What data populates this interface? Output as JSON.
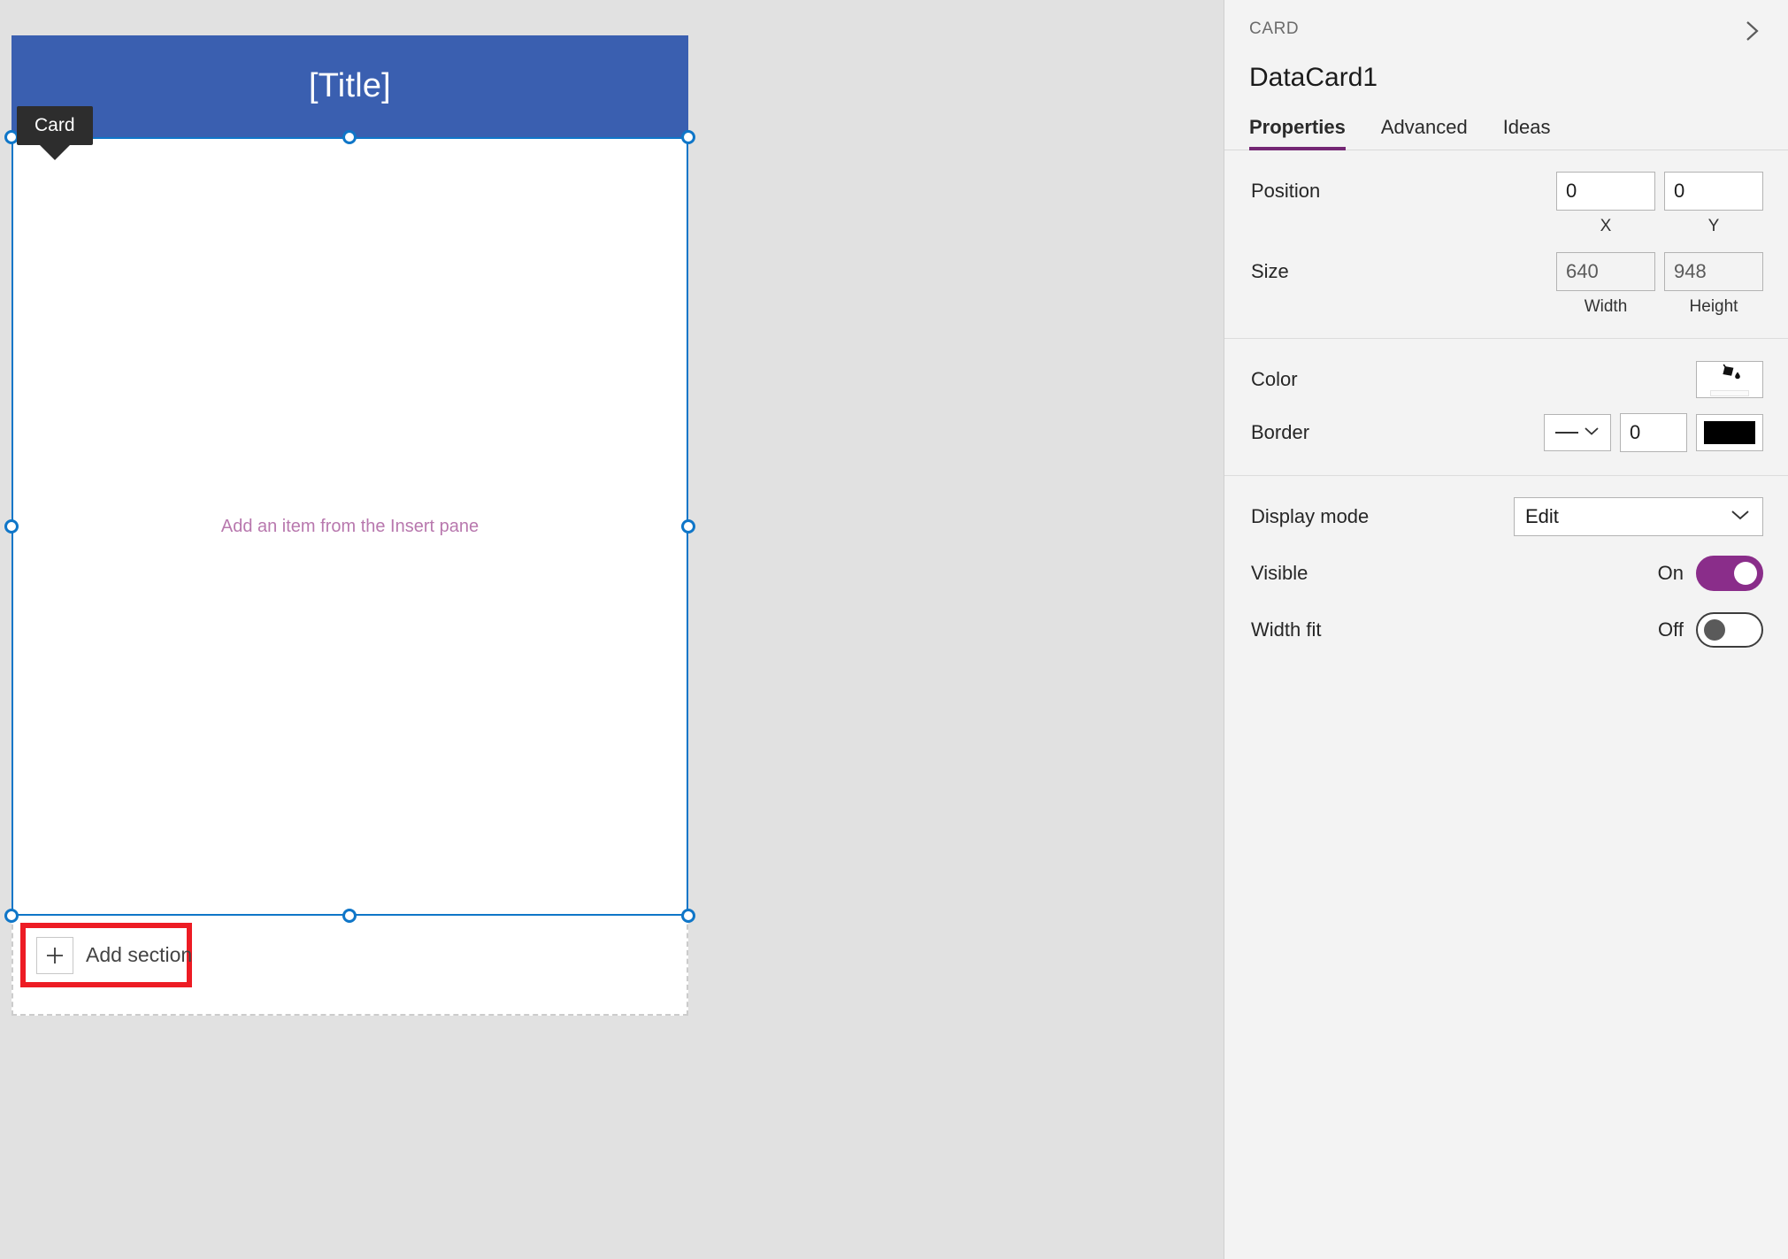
{
  "canvas": {
    "card_tooltip_label": "Card",
    "card_header_title": "[Title]",
    "card_placeholder_text": "Add an item from the Insert pane",
    "add_section_label": "Add section",
    "add_section_icon": "plus-icon",
    "highlight_color": "#ed1c24",
    "card_header_color": "#3a5fb0",
    "selection_color": "#0f76c8",
    "placeholder_text_color": "#b878ae",
    "background_color": "#e1e1e1"
  },
  "panel": {
    "breadcrumb": "CARD",
    "title": "DataCard1",
    "expand_icon": "chevron-right-icon",
    "accent_color": "#742774",
    "background_color": "#f3f3f3",
    "tabs": [
      {
        "label": "Properties",
        "active": true
      },
      {
        "label": "Advanced",
        "active": false
      },
      {
        "label": "Ideas",
        "active": false
      }
    ],
    "layout_group": {
      "position": {
        "label": "Position",
        "x_value": "0",
        "y_value": "0",
        "x_sub_label": "X",
        "y_sub_label": "Y"
      },
      "size": {
        "label": "Size",
        "width_value": "640",
        "height_value": "948",
        "width_sub_label": "Width",
        "height_sub_label": "Height"
      }
    },
    "appearance_group": {
      "color": {
        "label": "Color",
        "icon": "paint-bucket-icon",
        "swatch_color": "#fbfbfb"
      },
      "border": {
        "label": "Border",
        "style_icon": "solid-line-icon",
        "style_chevron": "chevron-down-icon",
        "thickness_value": "0",
        "swatch_color": "#000000"
      }
    },
    "behavior_group": {
      "display_mode": {
        "label": "Display mode",
        "value": "Edit",
        "chevron": "chevron-down-icon"
      },
      "visible": {
        "label": "Visible",
        "state_label": "On",
        "on": true
      },
      "width_fit": {
        "label": "Width fit",
        "state_label": "Off",
        "on": false
      }
    }
  }
}
